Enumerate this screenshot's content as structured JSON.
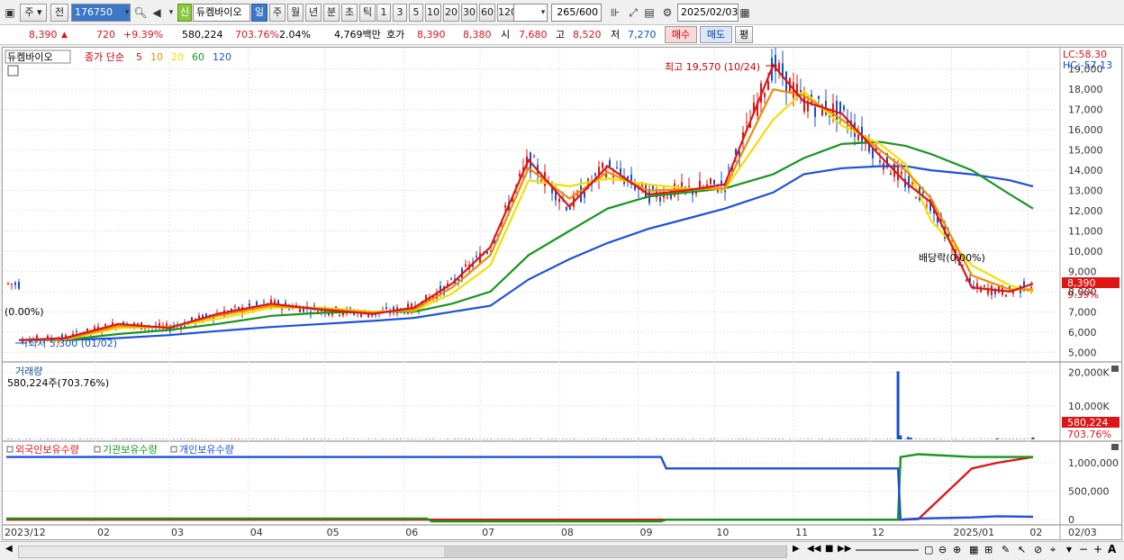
{
  "toolbar": {
    "market_type": "주",
    "market_scope": "전",
    "stock_code": "176750",
    "stock_name": "듀켐바이오",
    "badge_new": "신",
    "periods": [
      "일",
      "주",
      "월",
      "년",
      "분",
      "초",
      "틱"
    ],
    "selected_period": "일",
    "minute_options": [
      "1",
      "3",
      "5",
      "10",
      "20",
      "30",
      "60",
      "120"
    ],
    "count_value": "265",
    "count_total": "/600",
    "date": "2025/02/03"
  },
  "quote": {
    "price": "8,390",
    "change_arrow": "▲",
    "change": "720",
    "change_rate": "+9.39%",
    "volume": "580,224",
    "volume_rate": "703.76%",
    "turnover": "2.04%",
    "trade_value": "4,769백만",
    "bid_label": "호가",
    "ask_price": "8,390",
    "bid_price": "8,380",
    "open_label": "시",
    "open": "7,680",
    "high_label": "고",
    "high": "8,520",
    "low_label": "저",
    "low": "7,270",
    "buy_label": "매수",
    "sell_label": "매도",
    "eval_label": "평"
  },
  "price_panel": {
    "name": "듀켐바이오",
    "ma_label": "종가 단순",
    "ma_periods": [
      {
        "label": "5",
        "color": "#e01414"
      },
      {
        "label": "10",
        "color": "#f08c00"
      },
      {
        "label": "20",
        "color": "#f0e000"
      },
      {
        "label": "60",
        "color": "#16961e"
      },
      {
        "label": "120",
        "color": "#1e50dc"
      }
    ],
    "lc": "LC:58.30",
    "hc": "HC:-57.13",
    "y_ticks": [
      "19,000",
      "18,000",
      "17,000",
      "16,000",
      "15,000",
      "14,000",
      "13,000",
      "12,000",
      "11,000",
      "10,000",
      "9,000",
      "8,000",
      "7,000",
      "6,000",
      "5,000"
    ],
    "current_price_tag": "8,390",
    "current_rate_tag": "9.39%",
    "high_annotation": "최고 19,570 (10/24)",
    "low_annotation": "최저 5,300 (01/02)",
    "left_rate": "(0.00%)",
    "dividend_annotation": "배당락(0.00%)"
  },
  "volume_panel": {
    "title": "거래량",
    "subtitle": "580,224주(703.76%)",
    "y_ticks": [
      "20,000K",
      "10,000K"
    ],
    "current_tag": "580,224",
    "current_rate_tag": "703.76%"
  },
  "holdings_panel": {
    "legends": [
      {
        "label": "외국인보유수량",
        "color": "#e01414"
      },
      {
        "label": "기관보유수량",
        "color": "#16961e"
      },
      {
        "label": "개인보유수량",
        "color": "#1e50dc"
      }
    ],
    "y_ticks": [
      "1,000,000",
      "500,000",
      "0"
    ]
  },
  "x_axis": {
    "labels": [
      "2023/12",
      "02",
      "03",
      "04",
      "05",
      "06",
      "07",
      "08",
      "09",
      "10",
      "11",
      "12",
      "2025/01",
      "02",
      "02/03"
    ]
  },
  "chart_data": {
    "type": "line",
    "title": "",
    "x": [
      "2024-01-02",
      "2024-01-20",
      "2024-02-10",
      "2024-03-01",
      "2024-03-20",
      "2024-04-10",
      "2024-04-30",
      "2024-05-20",
      "2024-06-05",
      "2024-06-20",
      "2024-07-05",
      "2024-07-20",
      "2024-08-05",
      "2024-08-20",
      "2024-09-05",
      "2024-09-20",
      "2024-10-05",
      "2024-10-24",
      "2024-11-05",
      "2024-11-20",
      "2024-12-05",
      "2024-12-15",
      "2024-12-25",
      "2025-01-10",
      "2025-01-25",
      "2025-02-03"
    ],
    "series": [
      {
        "name": "5",
        "values": [
          5600,
          5700,
          6400,
          6200,
          6900,
          7400,
          7100,
          6900,
          7200,
          8400,
          10200,
          14500,
          12200,
          14200,
          12800,
          13000,
          13300,
          19200,
          17400,
          16800,
          14700,
          13400,
          12400,
          8200,
          8000,
          8390
        ]
      },
      {
        "name": "10",
        "values": [
          5600,
          5650,
          6300,
          6250,
          6800,
          7300,
          7150,
          6950,
          7100,
          8200,
          9800,
          14100,
          12600,
          13900,
          13000,
          13050,
          13100,
          18000,
          17700,
          16500,
          15000,
          14000,
          12600,
          8800,
          8100,
          8100
        ]
      },
      {
        "name": "20",
        "values": [
          5600,
          5620,
          6200,
          6250,
          6650,
          7200,
          7200,
          7000,
          7050,
          7900,
          9300,
          13500,
          13200,
          13600,
          13300,
          13100,
          13050,
          16500,
          17900,
          16200,
          15300,
          14300,
          11500,
          9300,
          8300,
          8000
        ]
      },
      {
        "name": "60",
        "values": [
          5600,
          5610,
          5900,
          6100,
          6400,
          6800,
          6950,
          7000,
          7000,
          7400,
          8000,
          9800,
          11000,
          12100,
          12700,
          12900,
          13100,
          13800,
          14600,
          15300,
          15400,
          15200,
          14800,
          14000,
          12800,
          12100
        ]
      },
      {
        "name": "120",
        "values": [
          5600,
          5600,
          5700,
          5850,
          6050,
          6250,
          6400,
          6550,
          6700,
          7000,
          7300,
          8600,
          9600,
          10400,
          11100,
          11600,
          12100,
          12900,
          13800,
          14100,
          14200,
          14200,
          14000,
          13800,
          13500,
          13200
        ]
      }
    ],
    "y_range": [
      4700,
      19700
    ],
    "volume": {
      "x": [
        "2024-12-12",
        "2024-12-13",
        "2024-12-16",
        "2024-12-17",
        "2025-01-20",
        "2025-02-03"
      ],
      "values": [
        20300,
        1200,
        700,
        500,
        300,
        580
      ]
    },
    "holdings": {
      "x": [
        "2023-12-28",
        "2024-06-10",
        "2024-06-12",
        "2024-09-10",
        "2024-09-12",
        "2024-12-12",
        "2024-12-13",
        "2024-12-20",
        "2025-01-10",
        "2025-01-20",
        "2025-02-03"
      ],
      "series": [
        {
          "name": "외국인보유수량",
          "values": [
            0,
            0,
            0,
            0,
            0,
            0,
            0,
            10000,
            900000,
            1000000,
            1100000
          ]
        },
        {
          "name": "기관보유수량",
          "values": [
            20000,
            20000,
            -30000,
            -30000,
            0,
            0,
            1100000,
            1150000,
            1100000,
            1100000,
            1100000
          ]
        },
        {
          "name": "개인보유수량",
          "values": [
            1100000,
            1100000,
            1100000,
            1100000,
            900000,
            900000,
            0,
            20000,
            40000,
            60000,
            50000
          ]
        }
      ],
      "y_range": [
        -60000,
        1300000
      ]
    },
    "legend": "top-left",
    "grid": true
  }
}
